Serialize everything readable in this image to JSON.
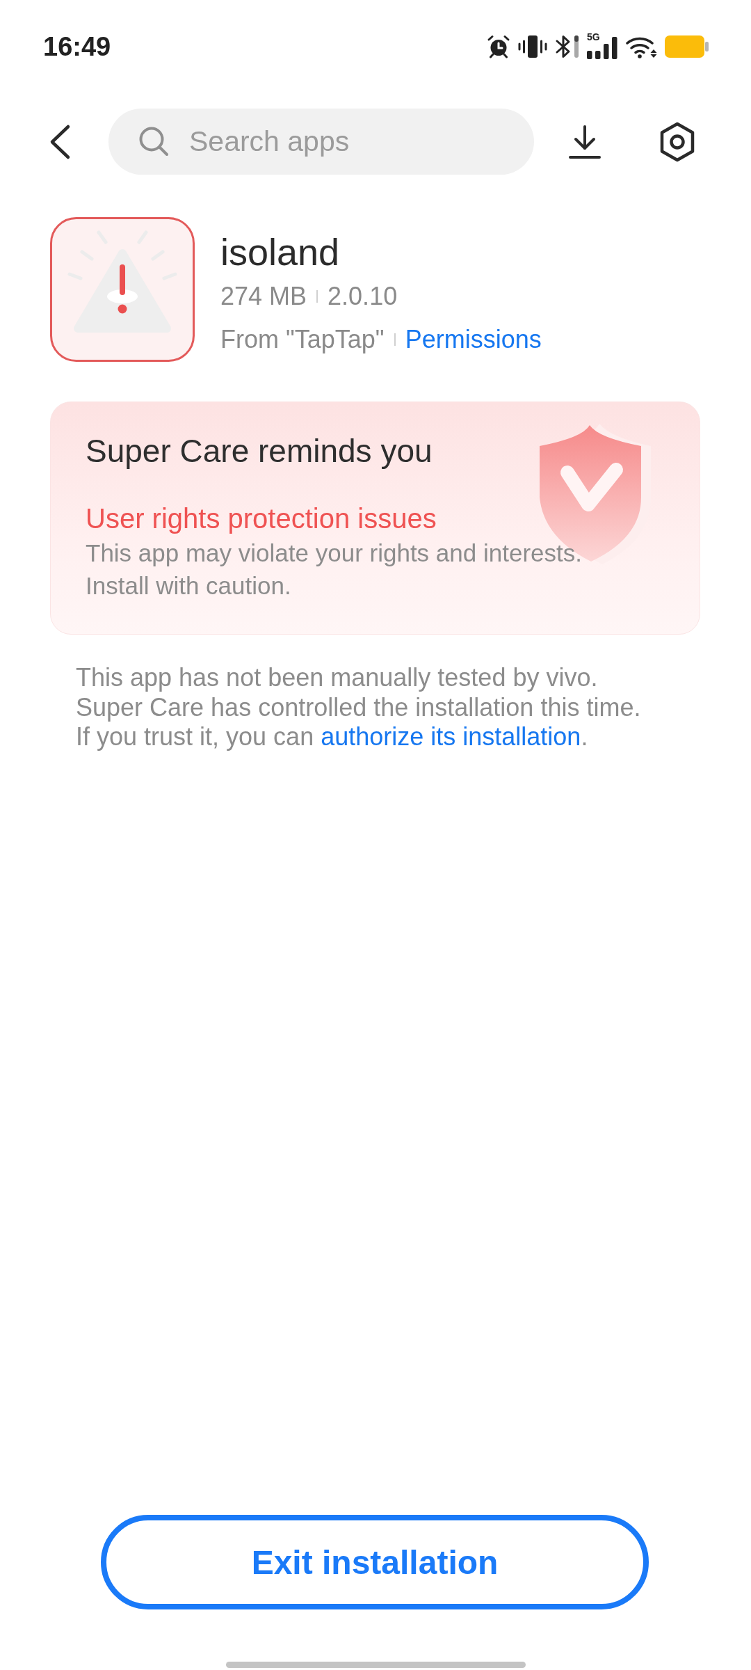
{
  "status_bar": {
    "time": "16:49",
    "network_type": "5G"
  },
  "header": {
    "search": {
      "placeholder": "Search apps"
    }
  },
  "app": {
    "name": "isoland",
    "size": "274 MB",
    "version": "2.0.10",
    "source": "From \"TapTap\"",
    "permissions_link": "Permissions"
  },
  "warning_card": {
    "title": "Super Care reminds you",
    "issue": "User rights protection issues",
    "message": "This app may violate your rights and interests.\nInstall with caution."
  },
  "notice": {
    "text": "This app has not been manually tested by vivo.\nSuper Care has controlled the installation this time.\nIf you trust it, you can ",
    "link": "authorize its installation",
    "text_after_link": "."
  },
  "exit_button": {
    "label": "Exit installation"
  }
}
